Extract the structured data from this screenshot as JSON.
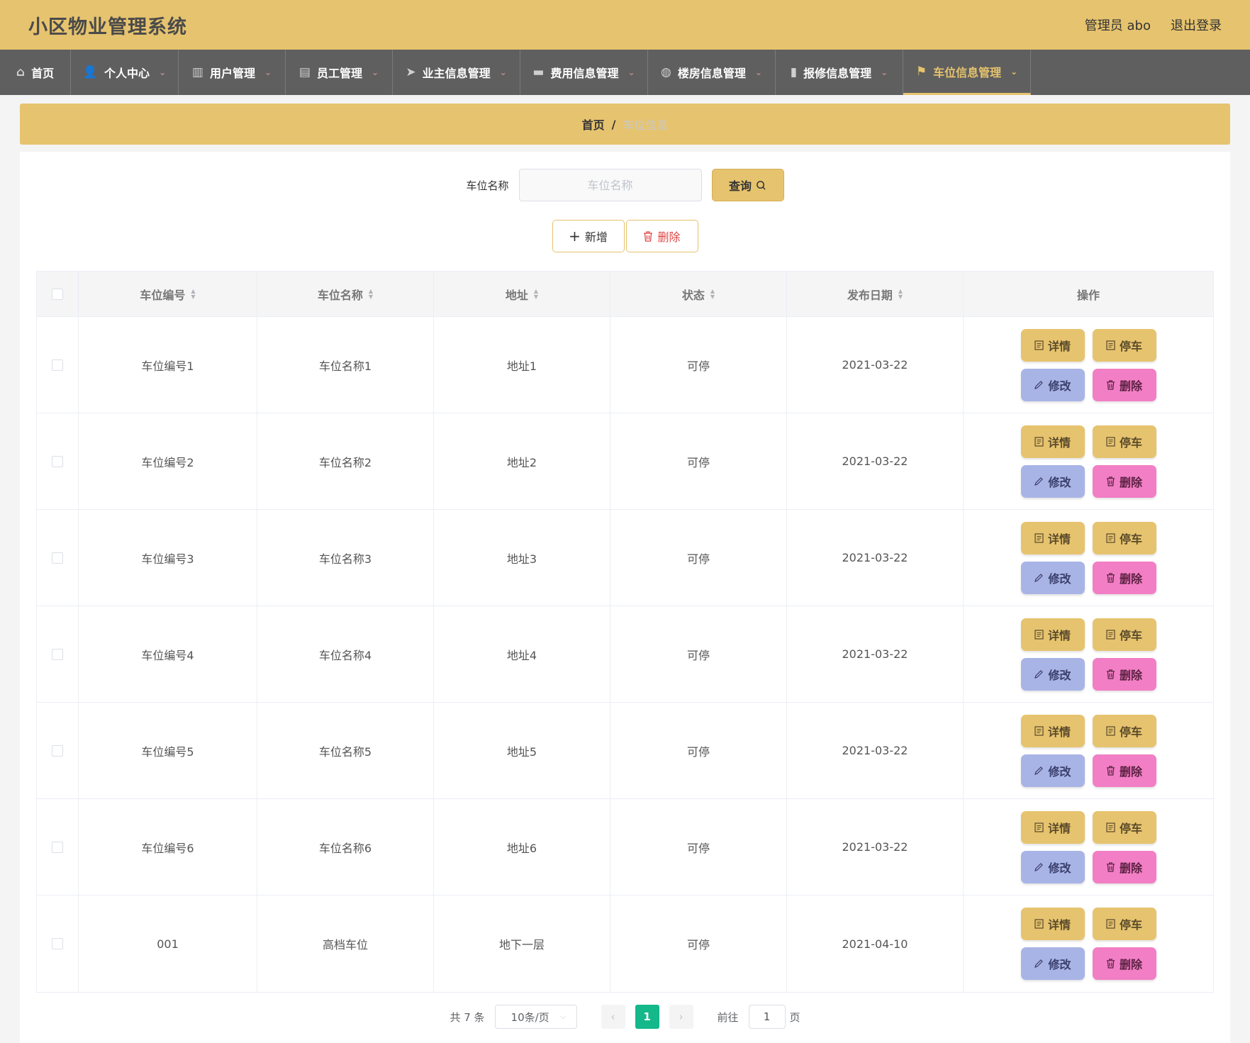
{
  "header": {
    "app_title": "小区物业管理系统",
    "admin_label": "管理员 abo",
    "logout_label": "退出登录"
  },
  "nav": [
    {
      "label": "首页",
      "icon": "home-icon",
      "glyph": "⌂",
      "has_dropdown": false,
      "width": 100
    },
    {
      "label": "个人中心",
      "icon": "user-icon",
      "glyph": "👤",
      "has_dropdown": true,
      "width": 152
    },
    {
      "label": "用户管理",
      "icon": "book-icon",
      "glyph": "▥",
      "has_dropdown": true,
      "width": 151
    },
    {
      "label": "员工管理",
      "icon": "chat-icon",
      "glyph": "▤",
      "has_dropdown": true,
      "width": 151
    },
    {
      "label": "业主信息管理",
      "icon": "send-icon",
      "glyph": "➤",
      "has_dropdown": true,
      "width": 180
    },
    {
      "label": "费用信息管理",
      "icon": "briefcase-icon",
      "glyph": "▬",
      "has_dropdown": true,
      "width": 180
    },
    {
      "label": "楼房信息管理",
      "icon": "compass-icon",
      "glyph": "◍",
      "has_dropdown": true,
      "width": 180
    },
    {
      "label": "报修信息管理",
      "icon": "bar-chart-icon",
      "glyph": "▮",
      "has_dropdown": true,
      "width": 180
    },
    {
      "label": "车位信息管理",
      "icon": "flag-icon",
      "glyph": "⚑",
      "has_dropdown": true,
      "width": 180,
      "active": true
    }
  ],
  "breadcrumb": {
    "home": "首页",
    "separator": "/",
    "current": "车位信息"
  },
  "search": {
    "label": "车位名称",
    "placeholder": "车位名称",
    "value": "",
    "button_label": "查询"
  },
  "actions": {
    "add_label": "新增",
    "delete_label": "删除"
  },
  "table": {
    "columns": [
      "车位编号",
      "车位名称",
      "地址",
      "状态",
      "发布日期",
      "操作"
    ],
    "op_labels": {
      "detail": "详情",
      "park": "停车",
      "edit": "修改",
      "delete": "删除"
    },
    "rows": [
      {
        "code": "车位编号1",
        "name": "车位名称1",
        "address": "地址1",
        "status": "可停",
        "date": "2021-03-22"
      },
      {
        "code": "车位编号2",
        "name": "车位名称2",
        "address": "地址2",
        "status": "可停",
        "date": "2021-03-22"
      },
      {
        "code": "车位编号3",
        "name": "车位名称3",
        "address": "地址3",
        "status": "可停",
        "date": "2021-03-22"
      },
      {
        "code": "车位编号4",
        "name": "车位名称4",
        "address": "地址4",
        "status": "可停",
        "date": "2021-03-22"
      },
      {
        "code": "车位编号5",
        "name": "车位名称5",
        "address": "地址5",
        "status": "可停",
        "date": "2021-03-22"
      },
      {
        "code": "车位编号6",
        "name": "车位名称6",
        "address": "地址6",
        "status": "可停",
        "date": "2021-03-22"
      },
      {
        "code": "001",
        "name": "高档车位",
        "address": "地下一层",
        "status": "可停",
        "date": "2021-04-10"
      }
    ]
  },
  "pagination": {
    "total_label": "共 7 条",
    "page_size_label": "10条/页",
    "current_page": "1",
    "goto_label": "前往",
    "goto_value": "1",
    "page_suffix": "页"
  },
  "colors": {
    "accent": "#e6c36e",
    "nav_bg": "#5f5f5f",
    "edit": "#a9b4e6",
    "delete": "#f27ec5",
    "page_active": "#14b88a"
  }
}
